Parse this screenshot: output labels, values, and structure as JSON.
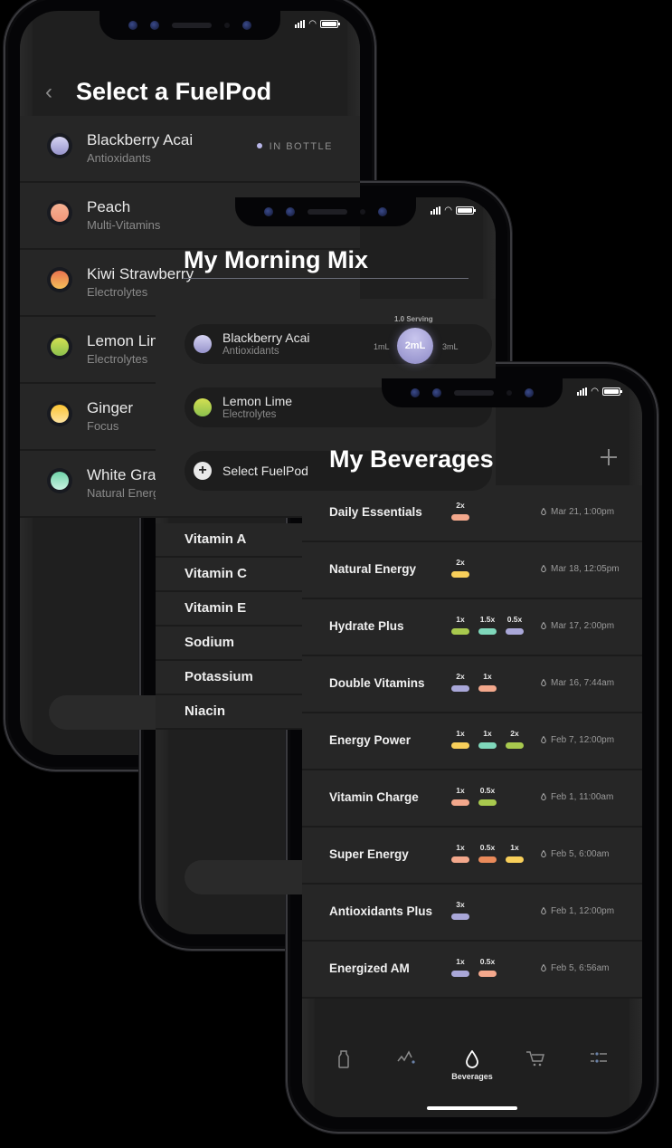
{
  "status_bar": {
    "signal": "signal-icon",
    "wifi": "wifi-icon",
    "battery": "battery-icon"
  },
  "screen1": {
    "title": "Select a FuelPod",
    "back_icon": "chevron-left-icon",
    "pods": [
      {
        "name": "Blackberry Acai",
        "category": "Antioxidants",
        "badge": "IN BOTTLE",
        "color_top": "#d6d4f2",
        "color_bottom": "#9794cc"
      },
      {
        "name": "Peach",
        "category": "Multi-Vitamins",
        "badge": "",
        "color_top": "#f5b193",
        "color_bottom": "#f0967a"
      },
      {
        "name": "Kiwi Strawberry",
        "category": "Electrolytes",
        "badge": "",
        "color_top": "#e8724f",
        "color_bottom": "#f5c05a"
      },
      {
        "name": "Lemon Lime",
        "category": "Electrolytes",
        "badge": "",
        "color_top": "#d4e052",
        "color_bottom": "#8bc04e"
      },
      {
        "name": "Ginger",
        "category": "Focus",
        "badge": "",
        "color_top": "#fcc433",
        "color_bottom": "#fde3a0"
      },
      {
        "name": "White Grape",
        "category": "Natural Energy",
        "badge": "",
        "color_top": "#6fd3aa",
        "color_bottom": "#c9f2e2"
      }
    ]
  },
  "screen2": {
    "title": "My Morning Mix",
    "serving_label": "1.0 Serving",
    "ml_options": [
      "1mL",
      "2mL",
      "3mL"
    ],
    "ml_selected": "2mL",
    "chips": [
      {
        "name": "Blackberry Acai",
        "category": "Antioxidants",
        "color_top": "#d6d4f2",
        "color_bottom": "#9794cc"
      },
      {
        "name": "Lemon Lime",
        "category": "Electrolytes",
        "color_top": "#d4e052",
        "color_bottom": "#8bc04e"
      }
    ],
    "select_label": "Select FuelPod",
    "nutrients": [
      "Vitamin A",
      "Vitamin C",
      "Vitamin E",
      "Sodium",
      "Potassium",
      "Niacin"
    ]
  },
  "screen3": {
    "title": "My Beverages",
    "add_icon": "plus-icon",
    "beverages": [
      {
        "name": "Daily Essentials",
        "date": "Mar 21, 1:00pm",
        "doses": [
          {
            "amt": "2x",
            "color": "#f3a88c"
          }
        ]
      },
      {
        "name": "Natural Energy",
        "date": "Mar 18, 12:05pm",
        "doses": [
          {
            "amt": "2x",
            "color": "#f8cf5a"
          }
        ]
      },
      {
        "name": "Hydrate Plus",
        "date": "Mar 17, 2:00pm",
        "doses": [
          {
            "amt": "1x",
            "color": "#a8c94e"
          },
          {
            "amt": "1.5x",
            "color": "#7fd8bb"
          },
          {
            "amt": "0.5x",
            "color": "#a9a7d8"
          }
        ]
      },
      {
        "name": "Double Vitamins",
        "date": "Mar 16, 7:44am",
        "doses": [
          {
            "amt": "2x",
            "color": "#a9a7d8"
          },
          {
            "amt": "1x",
            "color": "#f3a88c"
          }
        ]
      },
      {
        "name": "Energy Power",
        "date": "Feb 7, 12:00pm",
        "doses": [
          {
            "amt": "1x",
            "color": "#f8cf5a"
          },
          {
            "amt": "1x",
            "color": "#7fd8bb"
          },
          {
            "amt": "2x",
            "color": "#a8c94e"
          }
        ]
      },
      {
        "name": "Vitamin Charge",
        "date": "Feb 1, 11:00am",
        "doses": [
          {
            "amt": "1x",
            "color": "#f3a88c"
          },
          {
            "amt": "0.5x",
            "color": "#a8c94e"
          }
        ]
      },
      {
        "name": "Super Energy",
        "date": "Feb 5, 6:00am",
        "doses": [
          {
            "amt": "1x",
            "color": "#f3a88c"
          },
          {
            "amt": "0.5x",
            "color": "#e98a5a"
          },
          {
            "amt": "1x",
            "color": "#f8cf5a"
          }
        ]
      },
      {
        "name": "Antioxidants Plus",
        "date": "Feb 1, 12:00pm",
        "doses": [
          {
            "amt": "3x",
            "color": "#a9a7d8"
          }
        ]
      },
      {
        "name": "Energized AM",
        "date": "Feb 5, 6:56am",
        "doses": [
          {
            "amt": "1x",
            "color": "#a9a7d8"
          },
          {
            "amt": "0.5x",
            "color": "#f3a88c"
          }
        ]
      }
    ],
    "tabs": [
      {
        "icon": "bottle-icon",
        "label": ""
      },
      {
        "icon": "activity-icon",
        "label": ""
      },
      {
        "icon": "drop-icon",
        "label": "Beverages",
        "active": true
      },
      {
        "icon": "cart-icon",
        "label": ""
      },
      {
        "icon": "settings-sliders-icon",
        "label": ""
      }
    ]
  }
}
